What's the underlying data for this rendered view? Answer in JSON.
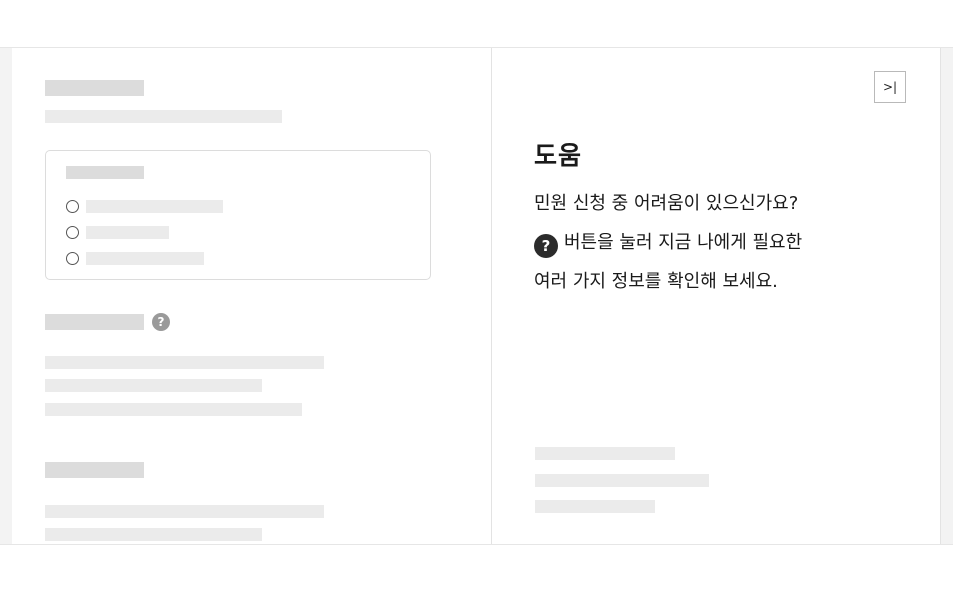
{
  "help": {
    "collapse_icon": "collapse-panel-icon",
    "collapse_glyph": ">|",
    "title": "도움",
    "line1": "민원 신청 중 어려움이 있으신가요?",
    "question_glyph": "?",
    "line2": "버튼을 눌러 지금 나에게 필요한",
    "line3": "여러 가지 정보를 확인해 보세요."
  },
  "main": {
    "help_icon_glyph": "?"
  },
  "colors": {
    "skeleton": "#dcdcdc",
    "background": "#f3f3f3",
    "text": "#1a1a1a"
  }
}
